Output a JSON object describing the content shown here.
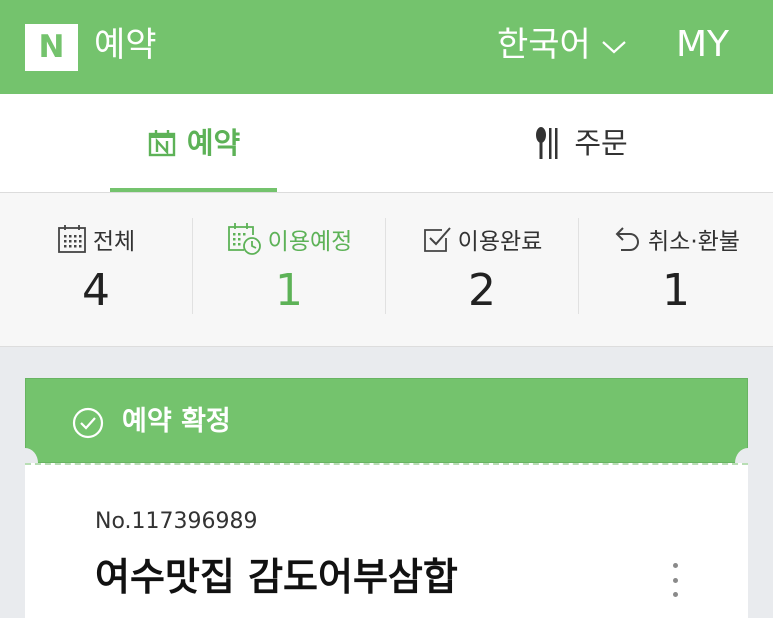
{
  "header": {
    "logo": "N",
    "title": "예약",
    "language": "한국어",
    "my": "MY"
  },
  "main_tabs": [
    {
      "label": "예약",
      "icon": "calendar-n-icon",
      "active": true
    },
    {
      "label": "주문",
      "icon": "fork-knife-icon",
      "active": false
    }
  ],
  "status_filters": [
    {
      "label": "전체",
      "count": "4",
      "icon": "calendar-grid-icon",
      "active": false
    },
    {
      "label": "이용예정",
      "count": "1",
      "icon": "calendar-clock-icon",
      "active": true
    },
    {
      "label": "이용완료",
      "count": "2",
      "icon": "checkbox-icon",
      "active": false
    },
    {
      "label": "취소·환불",
      "count": "1",
      "icon": "undo-arrow-icon",
      "active": false
    }
  ],
  "booking_card": {
    "status": "예약 확정",
    "booking_no": "No.117396989",
    "place_name": "여수맛집 감도어부삼합"
  },
  "colors": {
    "brand_green": "#74c36d",
    "active_green": "#5db257",
    "text_dark": "#222222"
  }
}
